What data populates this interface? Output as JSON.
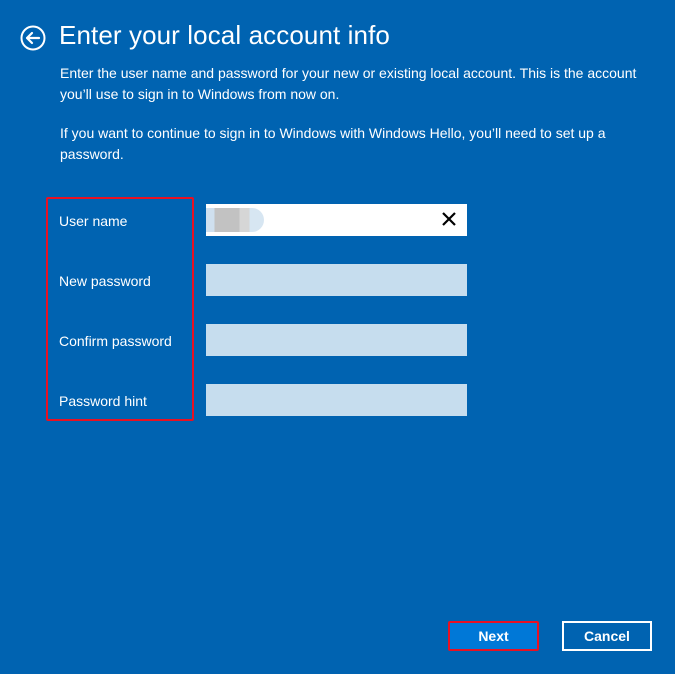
{
  "header": {
    "back_icon": "arrow-left-circle-icon",
    "title": "Enter your local account info"
  },
  "description": {
    "paragraph1": "Enter the user name and password for your new or existing local account. This is the account you’ll use to sign in to Windows from now on.",
    "paragraph2": "If you want to continue to sign in to Windows with Windows Hello, you’ll need to set up a password."
  },
  "form": {
    "fields": [
      {
        "label": "User name",
        "value": "[redacted]",
        "placeholder": "",
        "clear_icon": "close-x-icon"
      },
      {
        "label": "New password",
        "value": "",
        "placeholder": ""
      },
      {
        "label": "Confirm password",
        "value": "",
        "placeholder": ""
      },
      {
        "label": "Password hint",
        "value": "",
        "placeholder": ""
      }
    ]
  },
  "buttons": {
    "next": "Next",
    "cancel": "Cancel"
  },
  "colors": {
    "background": "#0063B1",
    "highlight": "#E81123",
    "primary_button": "#0078D7",
    "input_inactive": "#C6DDEE"
  }
}
